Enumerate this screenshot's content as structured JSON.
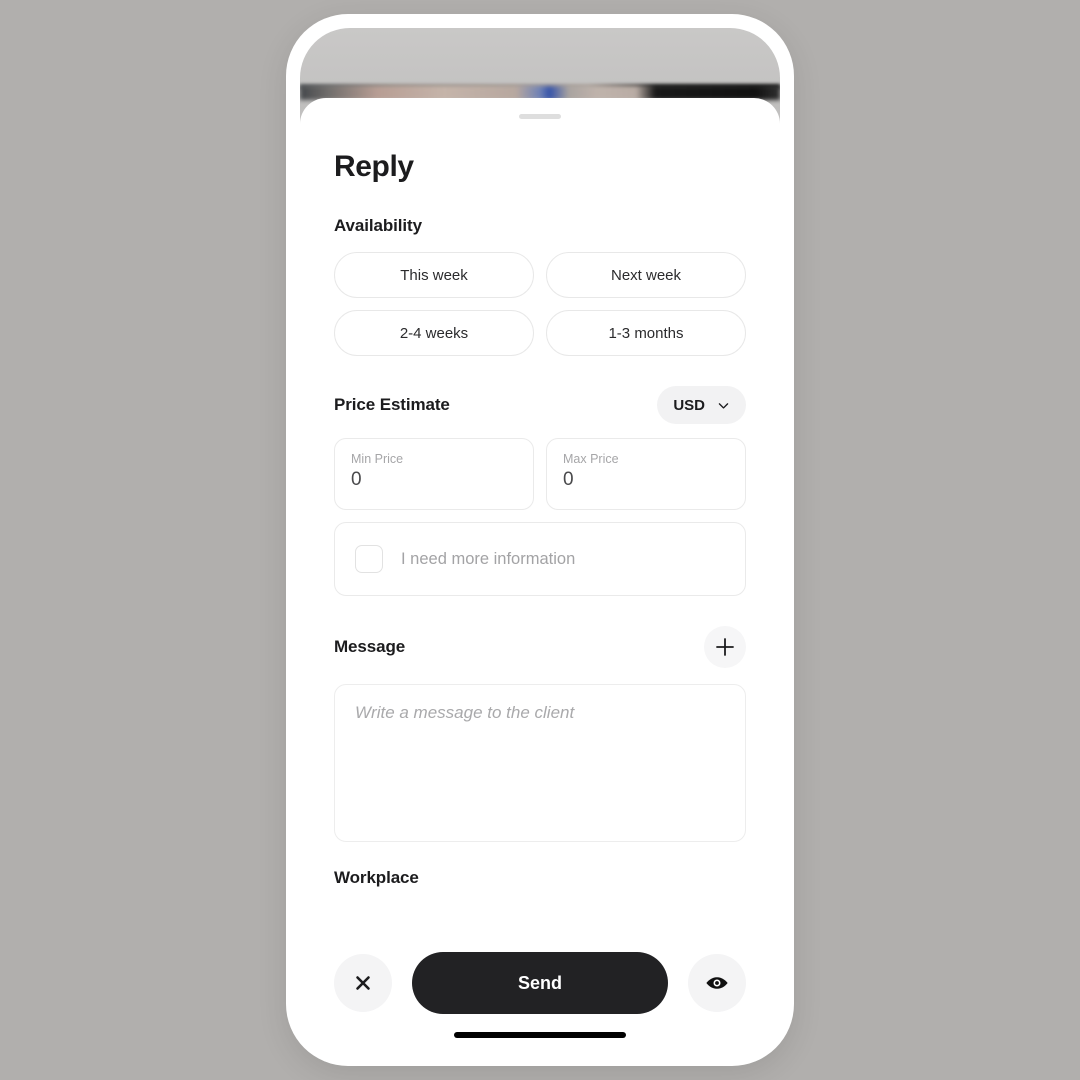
{
  "sheet": {
    "title": "Reply",
    "drag_handle": "drag-handle"
  },
  "availability": {
    "label": "Availability",
    "options": [
      {
        "label": "This week",
        "selected": false
      },
      {
        "label": "Next week",
        "selected": false
      },
      {
        "label": "2-4 weeks",
        "selected": false
      },
      {
        "label": "1-3 months",
        "selected": false
      }
    ]
  },
  "price_estimate": {
    "label": "Price Estimate",
    "currency": {
      "value": "USD",
      "icon": "chevron-down-icon"
    },
    "min_price": {
      "label": "Min Price",
      "value": "0"
    },
    "max_price": {
      "label": "Max Price",
      "value": "0"
    },
    "more_information": {
      "label": "I need more information",
      "checked": false
    }
  },
  "message": {
    "label": "Message",
    "add_icon": "plus-icon",
    "placeholder": "Write a message to the client",
    "value": ""
  },
  "workplace": {
    "label": "Workplace"
  },
  "action_bar": {
    "close_icon": "close-icon",
    "send_label": "Send",
    "preview_icon": "eye-icon"
  },
  "colors": {
    "page_background": "#b1afad",
    "sheet_background": "#ffffff",
    "text_primary": "#1c1c1e",
    "text_muted": "#a6a6a8",
    "accent_dark": "#222224",
    "pill_background": "#f2f2f3",
    "border": "#eaeaea"
  }
}
